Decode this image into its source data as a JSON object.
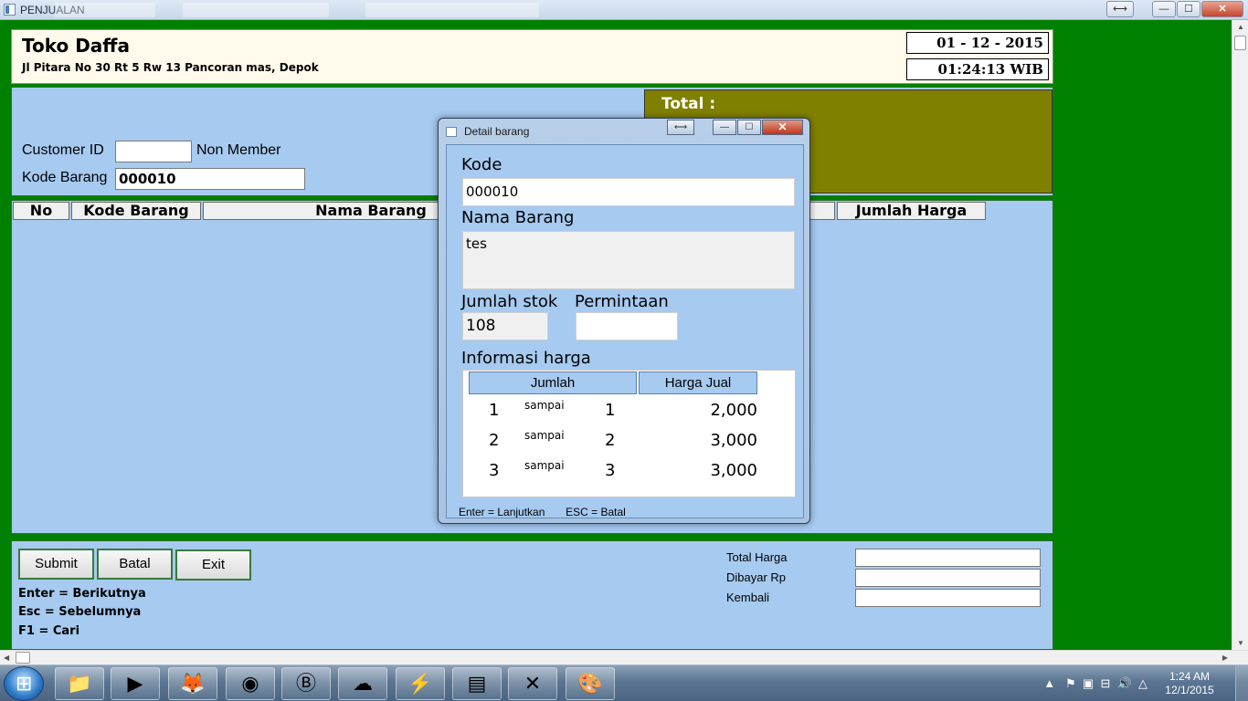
{
  "window": {
    "title": "PENJUALAN",
    "btn_resize": "⟷",
    "btn_min": "—",
    "btn_max": "☐",
    "btn_close": "✕"
  },
  "header": {
    "store_name": "Toko Daffa",
    "address": "Jl Pitara No 30 Rt 5 Rw 13 Pancoran mas, Depok",
    "date": "01 - 12 - 2015",
    "time": "01:24:13 WIB"
  },
  "customer": {
    "customer_id_label": "Customer ID",
    "customer_id_value": "",
    "member_status": "Non Member",
    "kode_barang_label": "Kode Barang",
    "kode_barang_value": "000010"
  },
  "total": {
    "label": "Total  :"
  },
  "grid": {
    "columns": [
      "No",
      "Kode Barang",
      "Nama Barang",
      "",
      "Jumlah Harga"
    ]
  },
  "buttons": {
    "submit": "Submit",
    "batal": "Batal",
    "exit": "Exit"
  },
  "help": {
    "enter": "Enter = Berikutnya",
    "esc": "Esc = Sebelumnya",
    "f1": "F1 = Cari"
  },
  "payment": {
    "total_harga": "Total Harga",
    "dibayar": "Dibayar Rp",
    "kembali": "Kembali"
  },
  "dialog": {
    "title": "Detail barang",
    "btn_resize": "⟷",
    "btn_min": "—",
    "btn_max": "☐",
    "btn_close": "✕",
    "kode_label": "Kode",
    "kode_value": "000010",
    "nama_label": "Nama Barang",
    "nama_value": "tes",
    "stok_label": "Jumlah stok",
    "stok_value": "108",
    "permintaan_label": "Permintaan",
    "permintaan_value": "",
    "info_label": "Informasi harga",
    "price_headers": [
      "Jumlah",
      "Harga Jual"
    ],
    "price_rows": [
      {
        "from": "1",
        "sep": "sampai",
        "to": "1",
        "price": "2,000"
      },
      {
        "from": "2",
        "sep": "sampai",
        "to": "2",
        "price": "3,000"
      },
      {
        "from": "3",
        "sep": "sampai",
        "to": "3",
        "price": "3,000"
      }
    ],
    "footer_enter": "Enter = Lanjutkan",
    "footer_esc": "ESC = Batal"
  },
  "taskbar": {
    "clock_time": "1:24 AM",
    "clock_date": "12/1/2015",
    "tray_icons": [
      "chevron-up",
      "flag",
      "device",
      "network",
      "volume",
      "drive"
    ],
    "apps": [
      "explorer",
      "media-player",
      "firefox",
      "chrome",
      "app-b",
      "app-yellow",
      "winamp",
      "document",
      "excel",
      "paint"
    ]
  }
}
